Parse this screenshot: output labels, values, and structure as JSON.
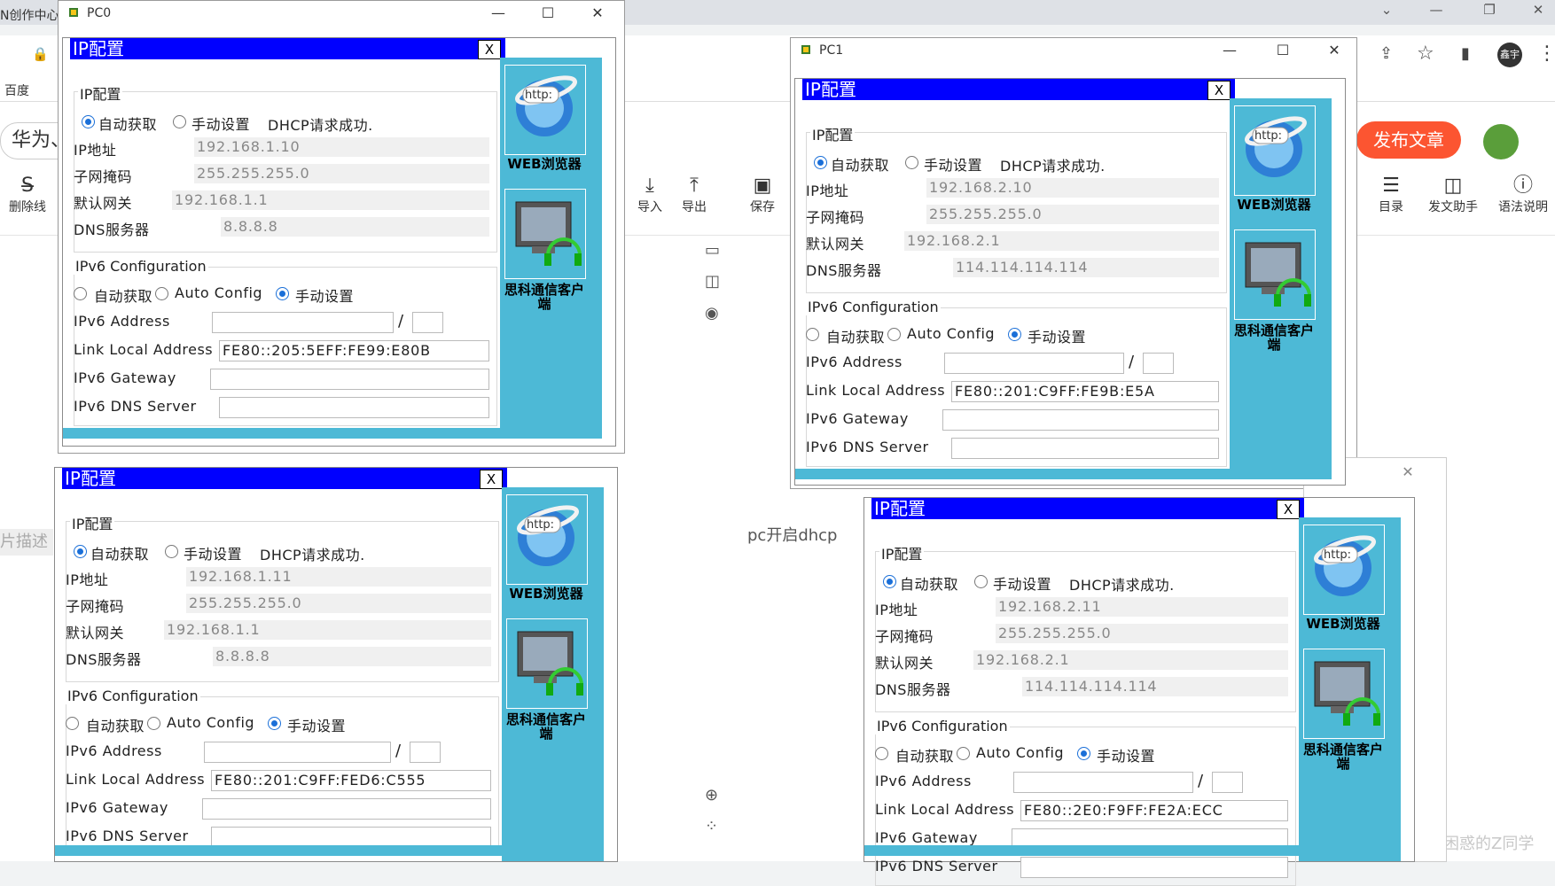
{
  "browser": {
    "tab_text": "N创作中心",
    "bookmark": "百度",
    "avatar_text": "鑫宇",
    "title_input": "华为、"
  },
  "editor_toolbar": {
    "strike": "删除线",
    "import": "导入",
    "export": "导出",
    "save": "保存",
    "toc": "目录",
    "assistant": "发文助手",
    "grammar": "语法说明",
    "publish": "发布文章"
  },
  "page": {
    "caption": "pc开启dhcp",
    "left_grey_text": "片描述",
    "watermark": "CSDN @困惑的Z同学"
  },
  "windows": {
    "pc0": {
      "title": "PC0"
    },
    "pc1": {
      "title": "PC1"
    }
  },
  "ipconfig_common": {
    "header": "IP配置",
    "close": "X",
    "section_ipv4": "IP配置",
    "radio_auto": "自动获取",
    "radio_manual": "手动设置",
    "ip_label": "IP地址",
    "mask_label": "子网掩码",
    "gateway_label": "默认网关",
    "dns_label": "DNS服务器",
    "section_ipv6": "IPv6 Configuration",
    "radio6_auto": "自动获取",
    "radio6_autoconfig": "Auto Config",
    "radio6_manual": "手动设置",
    "ipv6_addr_label": "IPv6 Address",
    "link_local_label": "Link Local Address",
    "ipv6_gw_label": "IPv6 Gateway",
    "ipv6_dns_label": "IPv6 DNS Server",
    "slash": "/",
    "web_label": "WEB浏览器",
    "client_label": "思科通信客户端",
    "http_text": "http:"
  },
  "panels": [
    {
      "status": "DHCP请求成功.",
      "ip": "192.168.1.10",
      "mask": "255.255.255.0",
      "gateway": "192.168.1.1",
      "dns": "8.8.8.8",
      "link_local": "FE80::205:5EFF:FE99:E80B"
    },
    {
      "status": "DHCP请求成功.",
      "ip": "192.168.2.10",
      "mask": "255.255.255.0",
      "gateway": "192.168.2.1",
      "dns": "114.114.114.114",
      "link_local": "FE80::201:C9FF:FE9B:E5A"
    },
    {
      "status": "DHCP请求成功.",
      "ip": "192.168.1.11",
      "mask": "255.255.255.0",
      "gateway": "192.168.1.1",
      "dns": "8.8.8.8",
      "link_local": "FE80::201:C9FF:FED6:C555"
    },
    {
      "status": "DHCP请求成功.",
      "ip": "192.168.2.11",
      "mask": "255.255.255.0",
      "gateway": "192.168.2.1",
      "dns": "114.114.114.114",
      "link_local": "FE80::2E0:F9FF:FE2A:ECC"
    }
  ]
}
